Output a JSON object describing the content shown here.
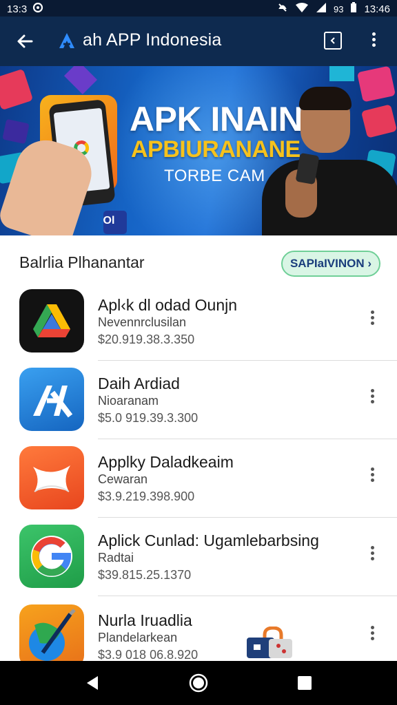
{
  "status_bar": {
    "time_left": "13:3",
    "time_right": "13:46",
    "battery": "93"
  },
  "app_bar": {
    "title": "ah APP Indonesia",
    "accent": "#2f8cff"
  },
  "banner": {
    "headline": "APK INAIN",
    "subheadline": "APBIURANANE",
    "tagline": "TORBE CAM",
    "sticker": "Ol"
  },
  "section": {
    "title": "Balrlia Plhanantar",
    "button_label": "SAPIaIVINON ›"
  },
  "apps": [
    {
      "name": "Apl‹k dl odad Ounjn",
      "subtitle": "Nevennrclusilan",
      "price": "$20.919.38.3.350",
      "icon": "drive-icon",
      "more_icon": "more-vert-icon"
    },
    {
      "name": "Daih Ardiad",
      "subtitle": "Nioaranam",
      "price": "$5.0 919.39.3.300",
      "icon": "app-store-icon",
      "more_icon": "more-vert-icon"
    },
    {
      "name": "Applky Daladkeaim",
      "subtitle": "Cewaran",
      "price": "$3.9.219.398.900",
      "icon": "paper-plane-icon",
      "more_icon": "more-vert-icon"
    },
    {
      "name": "Aplick Cunlad: Ugamlebarbsing",
      "subtitle": "Radtai",
      "price": "$39.815.25.1370",
      "icon": "google-icon",
      "more_icon": "more-vert-icon"
    },
    {
      "name": "Nurla Iruadlia",
      "subtitle": "Plandelarkean",
      "price": "$3.9 018 06.8.920",
      "icon": "maps-pen-icon",
      "more_icon": "more-vert-icon"
    }
  ],
  "nav": {
    "back": "back-triangle-icon",
    "home": "home-circle-icon",
    "recents": "recents-square-icon"
  }
}
